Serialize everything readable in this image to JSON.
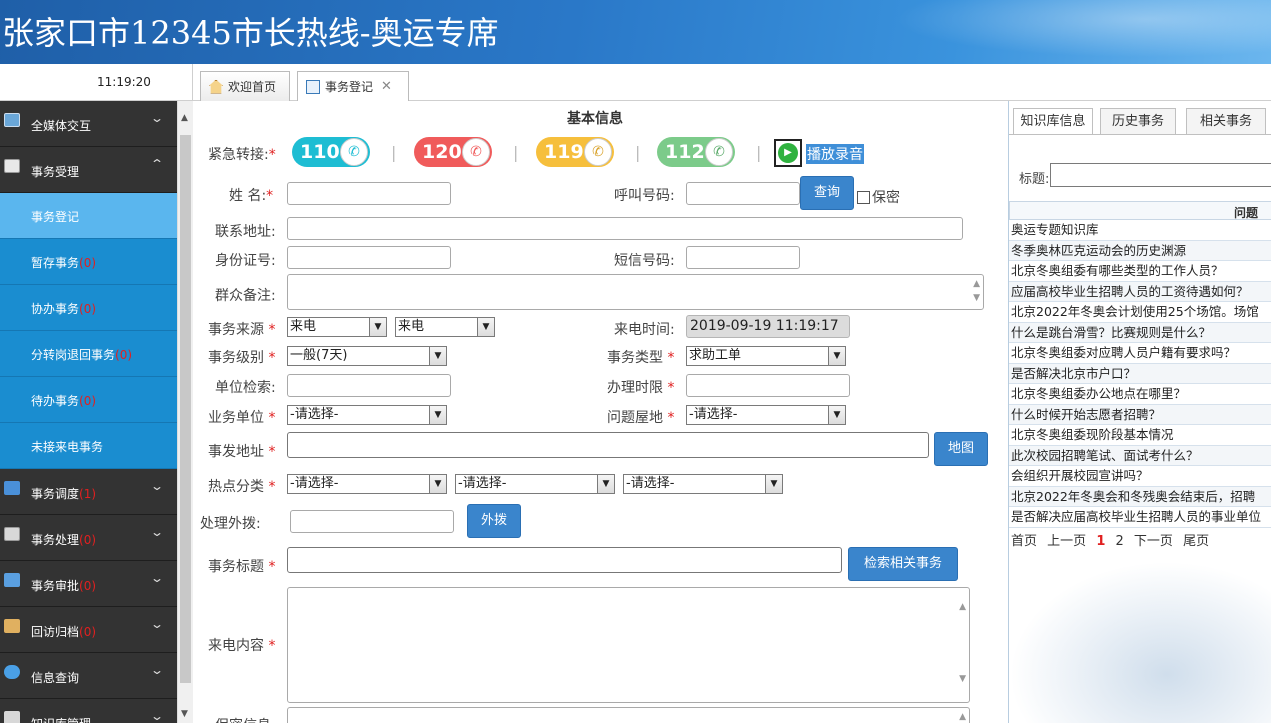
{
  "app": {
    "title": "张家口市12345市长热线-奥运专席"
  },
  "clock": "11:19:20",
  "sidebar": {
    "groups_top": [
      {
        "label": "全媒体交互",
        "icon": "media-icon",
        "count": ""
      },
      {
        "label": "事务受理",
        "icon": "accept-icon",
        "count": ""
      }
    ],
    "sub_items": [
      {
        "label": "事务登记",
        "count": ""
      },
      {
        "label": "暂存事务",
        "count": "(0)"
      },
      {
        "label": "协办事务",
        "count": "(0)"
      },
      {
        "label": "分转岗退回事务",
        "count": "(0)"
      },
      {
        "label": "待办事务",
        "count": "(0)"
      },
      {
        "label": "未接来电事务",
        "count": ""
      }
    ],
    "groups_bottom": [
      {
        "label": "事务调度",
        "count": "(1)"
      },
      {
        "label": "事务处理",
        "count": "(0)"
      },
      {
        "label": "事务审批",
        "count": "(0)"
      },
      {
        "label": "回访归档",
        "count": "(0)"
      },
      {
        "label": "信息查询",
        "count": ""
      },
      {
        "label": "知识库管理",
        "count": ""
      }
    ]
  },
  "tabs": [
    {
      "label": "欢迎首页"
    },
    {
      "label": "事务登记",
      "close": "✕"
    }
  ],
  "form": {
    "section_title": "基本信息",
    "emergency": {
      "label": "紧急转接:",
      "items": [
        {
          "num": "110",
          "color": "#1ebdd3"
        },
        {
          "num": "120",
          "color": "#f05b5b"
        },
        {
          "num": "119",
          "color": "#f6bf3c"
        },
        {
          "num": "112",
          "color": "#7ccb8a"
        }
      ],
      "play_label": "播放录音"
    },
    "name_label": "姓  名:",
    "caller_label": "呼叫号码:",
    "query_btn": "查询",
    "secret_label": "保密",
    "address_label": "联系地址:",
    "id_label": "身份证号:",
    "sms_label": "短信号码:",
    "remark_label": "群众备注:",
    "source_label": "事务来源",
    "source_value1": "来电",
    "source_value2": "来电",
    "call_time_label": "来电时间:",
    "call_time_value": "2019-09-19 11:19:17",
    "level_label": "事务级别",
    "level_value": "一般(7天)",
    "type_label": "事务类型",
    "type_value": "求助工单",
    "unit_search_label": "单位检索:",
    "deadline_label": "办理时限",
    "biz_unit_label": "业务单位",
    "biz_unit_value": "-请选择-",
    "area_label": "问题屋地",
    "area_value": "-请选择-",
    "event_addr_label": "事发地址",
    "map_btn": "地图",
    "hot_label": "热点分类",
    "hot_values": [
      "-请选择-",
      "-请选择-",
      "-请选择-"
    ],
    "dial_label": "处理外拨:",
    "dial_btn": "外拨",
    "subject_label": "事务标题",
    "search_related_btn": "检索相关事务",
    "content_label": "来电内容",
    "secret_info_label": "保密信息"
  },
  "right_panel": {
    "tabs": [
      "知识库信息",
      "历史事务",
      "相关事务"
    ],
    "keyword_label": "标题:",
    "column_header": "问题",
    "questions": [
      "奥运专题知识库",
      "冬季奥林匹克运动会的历史渊源",
      "北京冬奥组委有哪些类型的工作人员？",
      "应届高校毕业生招聘人员的工资待遇如何？",
      "北京2022年冬奥会计划使用25个场馆。场馆",
      "什么是跳台滑雪？比赛规则是什么？",
      "北京冬奥组委对应聘人员户籍有要求吗？",
      "是否解决北京市户口？",
      "北京冬奥组委办公地点在哪里？",
      "什么时候开始志愿者招聘？",
      "北京冬奥组委现阶段基本情况",
      "此次校园招聘笔试、面试考什么？",
      "会组织开展校园宣讲吗？",
      "北京2022年冬奥会和冬残奥会结束后，招聘",
      "是否解决应届高校毕业生招聘人员的事业单位"
    ],
    "pager": {
      "first": "首页",
      "prev": "上一页",
      "page1": "1",
      "page2": "2",
      "next": "下一页",
      "last": "尾页"
    }
  },
  "required_mark": "*"
}
